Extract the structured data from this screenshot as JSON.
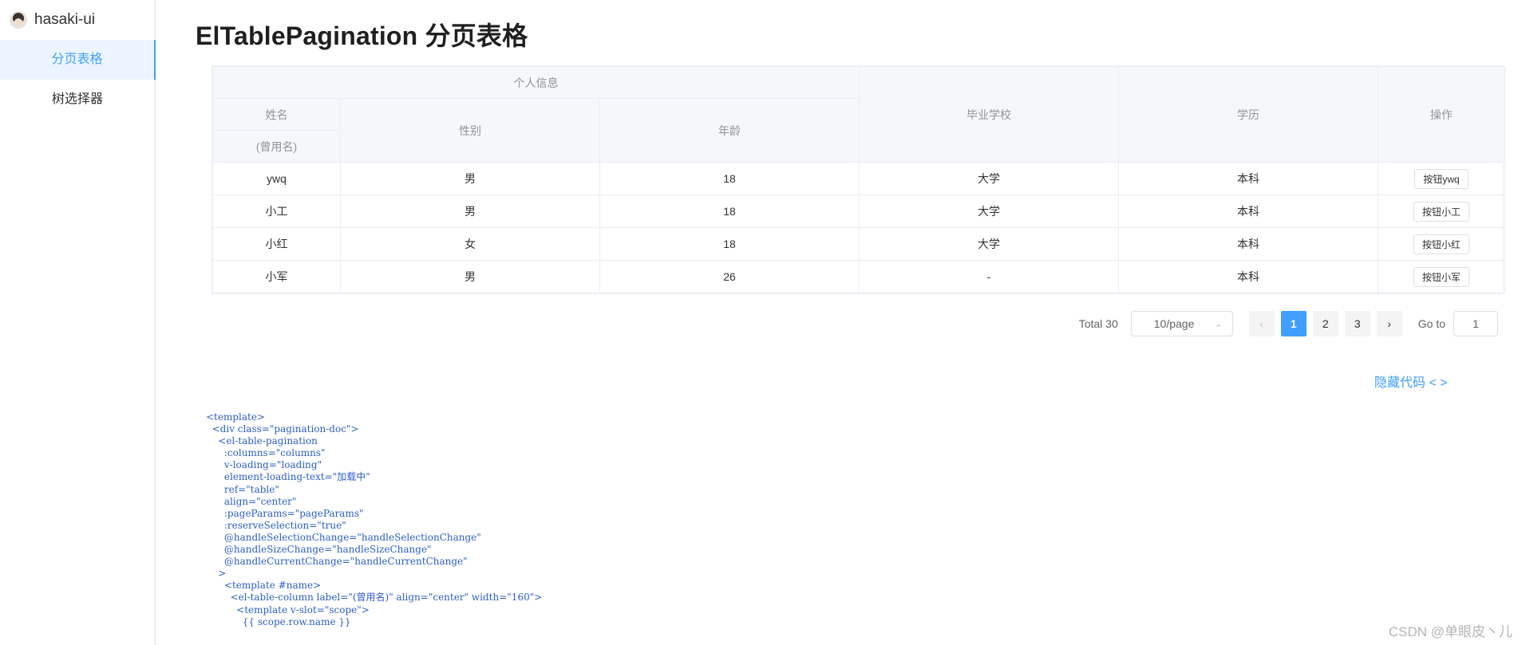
{
  "sidebar": {
    "brand": "hasaki-ui",
    "items": [
      {
        "label": "分页表格",
        "active": true
      },
      {
        "label": "树选择器",
        "active": false
      }
    ]
  },
  "main": {
    "title": "ElTablePagination 分页表格"
  },
  "table": {
    "group_header": "个人信息",
    "headers": {
      "name": "姓名",
      "alias": "(曾用名)",
      "gender": "性别",
      "age": "年龄",
      "school": "毕业学校",
      "degree": "学历",
      "op": "操作"
    },
    "rows": [
      {
        "name": "ywq",
        "gender": "男",
        "age": "18",
        "school": "大学",
        "degree": "本科",
        "button": "按钮ywq"
      },
      {
        "name": "小工",
        "gender": "男",
        "age": "18",
        "school": "大学",
        "degree": "本科",
        "button": "按钮小工"
      },
      {
        "name": "小红",
        "gender": "女",
        "age": "18",
        "school": "大学",
        "degree": "本科",
        "button": "按钮小红"
      },
      {
        "name": "小军",
        "gender": "男",
        "age": "26",
        "school": "-",
        "degree": "本科",
        "button": "按钮小军"
      }
    ]
  },
  "pagination": {
    "total": "Total 30",
    "page_size": "10/page",
    "prev_icon": "chevron-left-icon",
    "next_icon": "chevron-right-icon",
    "pages": [
      "1",
      "2",
      "3"
    ],
    "current_page": "1",
    "goto_label": "Go to",
    "goto_value": "1"
  },
  "toggle_code": "隐藏代码 < >",
  "code_lines": [
    "<template>",
    "  <div class=\"pagination-doc\">",
    "    <el-table-pagination",
    "      :columns=\"columns\"",
    "      v-loading=\"loading\"",
    "      element-loading-text=\"加载中\"",
    "      ref=\"table\"",
    "      align=\"center\"",
    "      :pageParams=\"pageParams\"",
    "      :reserveSelection=\"true\"",
    "      @handleSelectionChange=\"handleSelectionChange\"",
    "      @handleSizeChange=\"handleSizeChange\"",
    "      @handleCurrentChange=\"handleCurrentChange\"",
    "    >",
    "      <template #name>",
    "        <el-table-column label=\"(曾用名)\" align=\"center\" width=\"160\">",
    "          <template v-slot=\"scope\">",
    "            {{ scope.row.name }}"
  ],
  "watermark": "CSDN @单眼皮丶儿",
  "colors": {
    "accent": "#409eff",
    "active_bg": "#ecf5ff",
    "header_bg": "#f5f7fa",
    "border": "#ebeef5",
    "code_text": "#2d5ec7"
  }
}
